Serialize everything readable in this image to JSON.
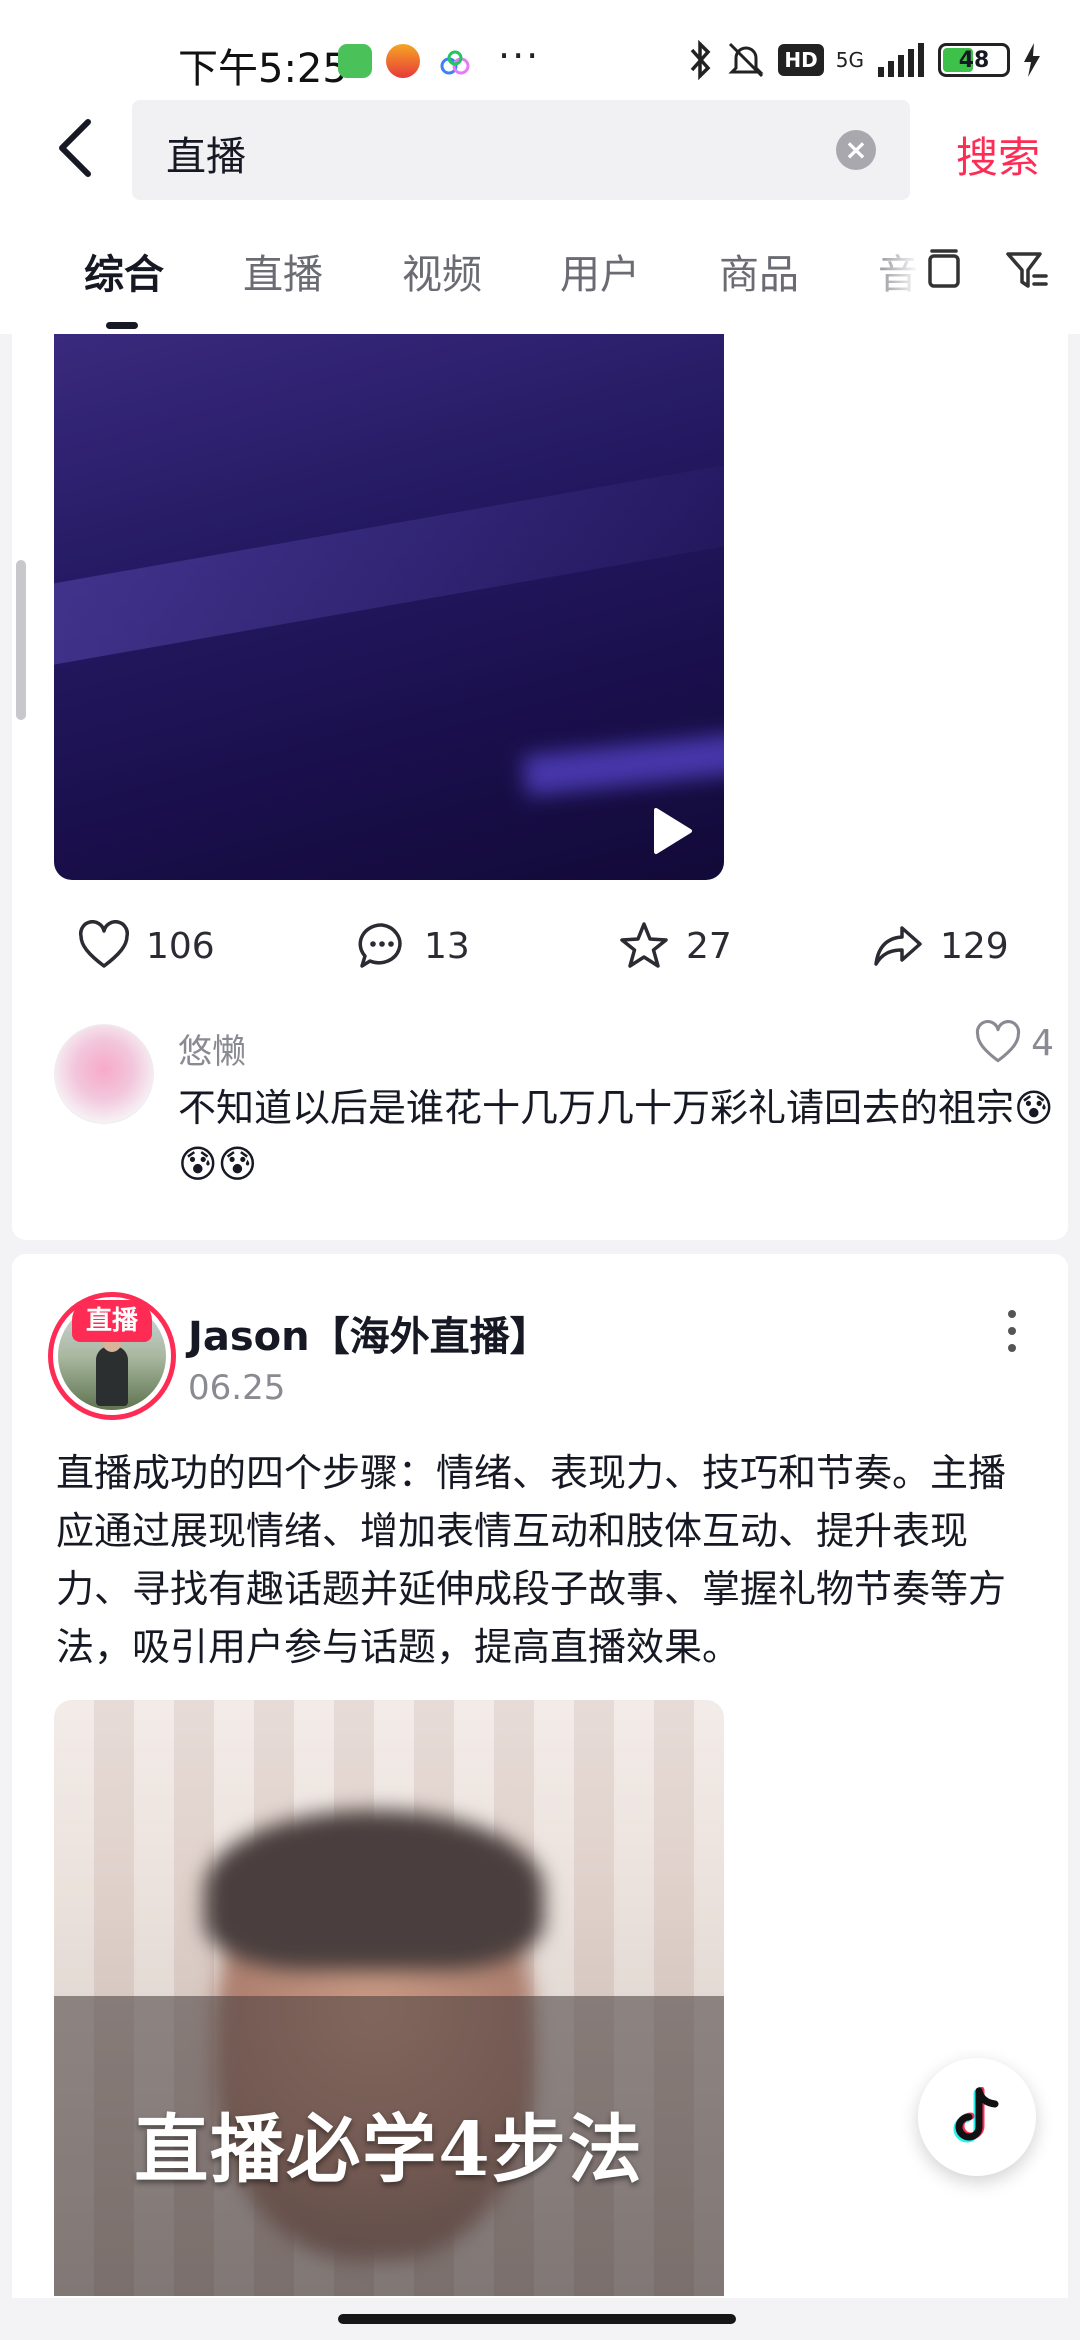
{
  "status_bar": {
    "time": "下午5:25",
    "more": "···",
    "hd": "HD",
    "network": "5G",
    "battery": "48"
  },
  "search": {
    "query": "直播",
    "submit_label": "搜索"
  },
  "tabs": [
    {
      "label": "综合",
      "active": true
    },
    {
      "label": "直播",
      "active": false
    },
    {
      "label": "视频",
      "active": false
    },
    {
      "label": "用户",
      "active": false
    },
    {
      "label": "商品",
      "active": false
    },
    {
      "label": "音",
      "active": false
    }
  ],
  "post1": {
    "actions": {
      "likes": "106",
      "comments": "13",
      "favorites": "27",
      "shares": "129"
    },
    "top_comment": {
      "author": "悠懒",
      "likes": "4",
      "text": "不知道以后是谁花十几万几十万彩礼请回去的祖宗😰😰😰"
    }
  },
  "post2": {
    "author": "Jason【海外直播】",
    "live_badge": "直播",
    "date": "06.25",
    "text": "直播成功的四个步骤：情绪、表现力、技巧和节奏。主播应通过展现情绪、增加表情互动和肢体互动、提升表现力、寻找有趣话题并延伸成段子故事、掌握礼物节奏等方法，吸引用户参与话题，提高直播效果。",
    "video_caption": "直播必学4步法"
  },
  "colors": {
    "accent": "#fe2c55",
    "text_primary": "#161823",
    "text_secondary": "#8a8a92"
  }
}
